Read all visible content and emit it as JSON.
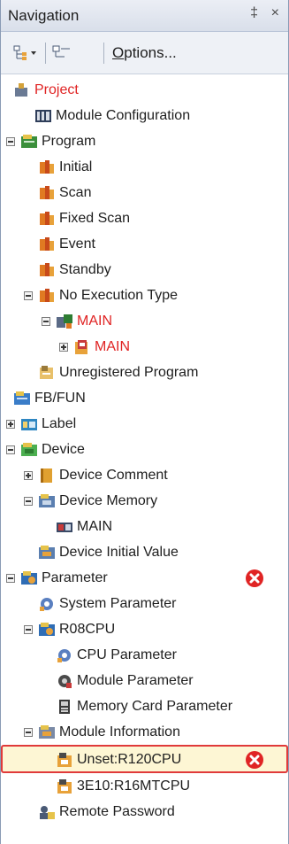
{
  "header": {
    "title": "Navigation",
    "pin_glyph": "‡",
    "close_glyph": "×"
  },
  "toolbar": {
    "options_label": "Options..."
  },
  "tree": {
    "items": [
      {
        "label": "Project",
        "icon": "project-icon",
        "color": "#e02424"
      },
      {
        "label": "Module Configuration",
        "icon": "module-config-icon"
      },
      {
        "label": "Program",
        "icon": "program-icon"
      },
      {
        "label": "Initial",
        "icon": "program-type-icon"
      },
      {
        "label": "Scan",
        "icon": "program-type-icon"
      },
      {
        "label": "Fixed Scan",
        "icon": "program-type-icon"
      },
      {
        "label": "Event",
        "icon": "program-type-icon"
      },
      {
        "label": "Standby",
        "icon": "program-type-icon"
      },
      {
        "label": "No Execution Type",
        "icon": "program-type-icon"
      },
      {
        "label": "MAIN",
        "icon": "program-block-icon",
        "color": "#e02424"
      },
      {
        "label": "MAIN",
        "icon": "program-file-icon",
        "color": "#e02424"
      },
      {
        "label": "Unregistered Program",
        "icon": "unregistered-program-icon"
      },
      {
        "label": "FB/FUN",
        "icon": "fb-fun-icon"
      },
      {
        "label": "Label",
        "icon": "label-icon"
      },
      {
        "label": "Device",
        "icon": "device-icon"
      },
      {
        "label": "Device Comment",
        "icon": "book-icon"
      },
      {
        "label": "Device Memory",
        "icon": "device-memory-icon"
      },
      {
        "label": "MAIN",
        "icon": "memory-file-icon"
      },
      {
        "label": "Device Initial Value",
        "icon": "initial-value-icon"
      },
      {
        "label": "Parameter",
        "icon": "parameter-icon",
        "error": true
      },
      {
        "label": "System Parameter",
        "icon": "gear-icon"
      },
      {
        "label": "R08CPU",
        "icon": "parameter-icon"
      },
      {
        "label": "CPU Parameter",
        "icon": "gear-icon"
      },
      {
        "label": "Module Parameter",
        "icon": "module-parameter-icon"
      },
      {
        "label": "Memory Card Parameter",
        "icon": "memory-card-icon"
      },
      {
        "label": "Module Information",
        "icon": "module-info-icon"
      },
      {
        "label": "Unset:R120CPU",
        "icon": "module-icon",
        "error": true,
        "selected": true
      },
      {
        "label": "3E10:R16MTCPU",
        "icon": "module-icon"
      },
      {
        "label": "Remote Password",
        "icon": "remote-password-icon"
      }
    ]
  },
  "colors": {
    "error": "#e02424",
    "selection_border": "#e03a3a",
    "selection_fill": "#fdf6d4"
  }
}
